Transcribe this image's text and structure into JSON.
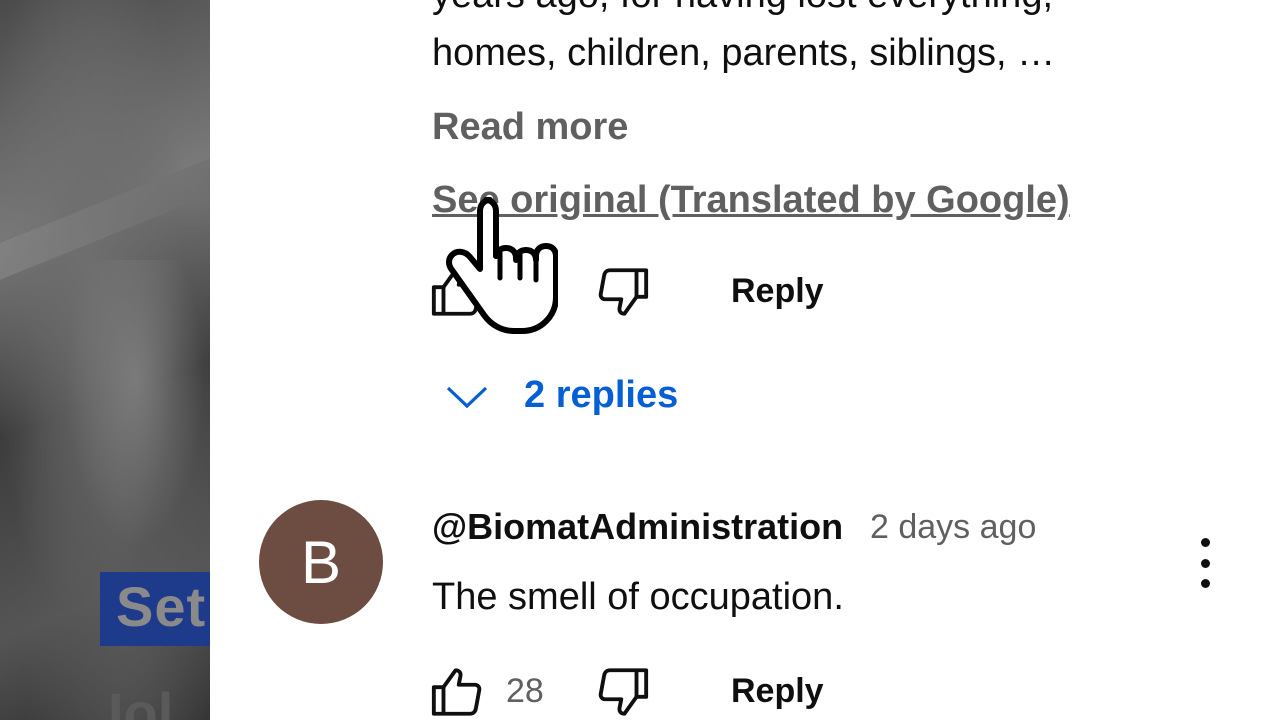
{
  "comment1": {
    "text_line1": "years ago, for having lost everything,",
    "text_line2": "homes, children, parents, siblings, …",
    "read_more": "Read more",
    "see_original": "See original (Translated by Google)",
    "reply_label": "Reply",
    "replies_toggle": "2 replies"
  },
  "comment2": {
    "avatar_letter": "B",
    "avatar_color": "#6d4c41",
    "author": "@BiomatAdministration",
    "time": "2 days ago",
    "text": "The smell of occupation.",
    "like_count": "28",
    "reply_label": "Reply"
  },
  "video": {
    "caption_fragment": "Set",
    "caption_fragment2": "Iol"
  },
  "colors": {
    "link_blue": "#065fd4",
    "text_primary": "#0f0f0f",
    "text_secondary": "#606060"
  },
  "icons": [
    "thumb-up-icon",
    "thumb-down-icon",
    "chevron-down-icon",
    "more-vert-icon",
    "hand-pointer-cursor-icon"
  ]
}
